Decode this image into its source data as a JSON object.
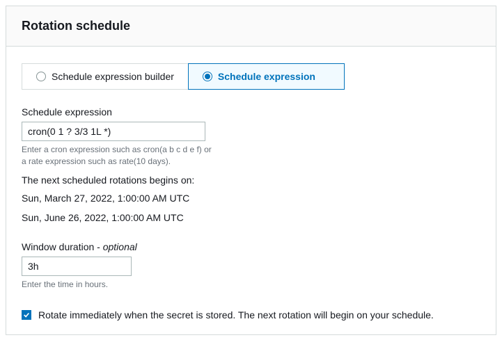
{
  "panel": {
    "title": "Rotation schedule"
  },
  "tabs": {
    "builder": {
      "label": "Schedule expression builder",
      "selected": false
    },
    "expression": {
      "label": "Schedule expression",
      "selected": true
    }
  },
  "scheduleExpression": {
    "label": "Schedule expression",
    "value": "cron(0 1 ? 3/3 1L *)",
    "help": "Enter a cron expression such as cron(a b c d e f) or a rate expression such as rate(10 days)."
  },
  "nextRotations": {
    "title": "The next scheduled rotations begins on:",
    "dates": [
      "Sun, March 27, 2022, 1:00:00 AM UTC",
      "Sun, June 26, 2022, 1:00:00 AM UTC"
    ]
  },
  "windowDuration": {
    "label": "Window duration - ",
    "optional": "optional",
    "value": "3h",
    "help": "Enter the time in hours."
  },
  "rotateImmediately": {
    "checked": true,
    "label": "Rotate immediately when the secret is stored. The next rotation will begin on your schedule."
  }
}
